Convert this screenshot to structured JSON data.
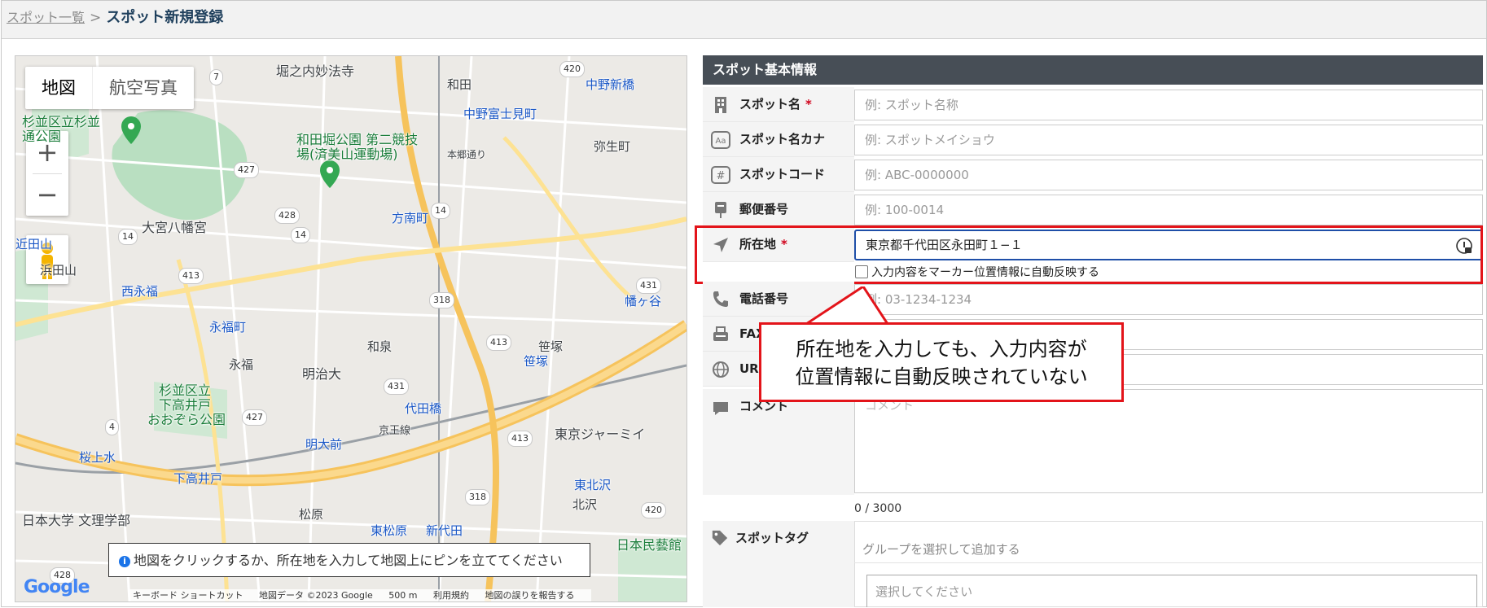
{
  "breadcrumb": {
    "parent": "スポット一覧",
    "separator": ">",
    "current": "スポット新規登録"
  },
  "map": {
    "types": [
      "地図",
      "航空写真"
    ],
    "zoom_in": "+",
    "zoom_out": "−",
    "hint": "地図をクリックするか、所在地を入力して地図上にピンを立ててください",
    "hint_icon": "i",
    "google": "Google",
    "footer": [
      "キーボード ショートカット",
      "地図データ ©2023 Google",
      "500 m",
      "利用規約",
      "地図の誤りを報告する"
    ],
    "labels": [
      {
        "t": "堀之内妙法寺",
        "c": ""
      },
      {
        "t": "和田",
        "c": ""
      },
      {
        "t": "中野新橋",
        "c": "blue"
      },
      {
        "t": "中野富士見町",
        "c": "blue"
      },
      {
        "t": "杉並区立杉並",
        "c": "green"
      },
      {
        "t": "通公園",
        "c": "green"
      },
      {
        "t": "和田堀公園 第二競技",
        "c": "green"
      },
      {
        "t": "場(済美山運動場)",
        "c": "green"
      },
      {
        "t": "本郷通り",
        "c": ""
      },
      {
        "t": "弥生町",
        "c": ""
      },
      {
        "t": "大宮八幡宮",
        "c": "big"
      },
      {
        "t": "方南町",
        "c": "blue"
      },
      {
        "t": "浜田山",
        "c": ""
      },
      {
        "t": "西永福",
        "c": "blue"
      },
      {
        "t": "永福町",
        "c": "blue"
      },
      {
        "t": "和泉",
        "c": ""
      },
      {
        "t": "幡ヶ谷",
        "c": "blue"
      },
      {
        "t": "笹塚",
        "c": ""
      },
      {
        "t": "笹塚",
        "c": "blue"
      },
      {
        "t": "永福",
        "c": ""
      },
      {
        "t": "明治大",
        "c": ""
      },
      {
        "t": "杉並区立",
        "c": "green"
      },
      {
        "t": "下高井戸",
        "c": "green"
      },
      {
        "t": "おおぞら公園",
        "c": "green"
      },
      {
        "t": "代田橋",
        "c": "blue"
      },
      {
        "t": "京王線",
        "c": ""
      },
      {
        "t": "明大前",
        "c": "blue"
      },
      {
        "t": "東京ジャーミイ",
        "c": "big"
      },
      {
        "t": "桜上水",
        "c": "blue"
      },
      {
        "t": "下高井戸",
        "c": "blue"
      },
      {
        "t": "東北沢",
        "c": "blue"
      },
      {
        "t": "北沢",
        "c": ""
      },
      {
        "t": "日本大学 文理学部",
        "c": "big"
      },
      {
        "t": "松原",
        "c": ""
      },
      {
        "t": "東松原",
        "c": "blue"
      },
      {
        "t": "新代田",
        "c": "blue"
      },
      {
        "t": "日本民藝館",
        "c": "green"
      },
      {
        "t": "近田山",
        "c": "blue"
      }
    ],
    "shields": [
      "7",
      "420",
      "427",
      "428",
      "14",
      "14",
      "14",
      "413",
      "318",
      "413",
      "431",
      "431",
      "4",
      "427",
      "413",
      "318",
      "420",
      "428"
    ]
  },
  "form": {
    "section_title": "スポット基本情報",
    "fields": [
      {
        "label": "スポット名",
        "required": true,
        "value": "",
        "placeholder": "例: スポット名称",
        "icon": "building-icon"
      },
      {
        "label": "スポット名カナ",
        "required": false,
        "value": "",
        "placeholder": "例: スポットメイショウ",
        "icon": "kana-icon"
      },
      {
        "label": "スポットコード",
        "required": false,
        "value": "",
        "placeholder": "例: ABC-0000000",
        "icon": "hash-icon"
      },
      {
        "label": "郵便番号",
        "required": false,
        "value": "",
        "placeholder": "例: 100-0014",
        "icon": "postbox-icon"
      },
      {
        "label": "所在地",
        "required": true,
        "value": "東京都千代田区永田町１−１",
        "placeholder": "",
        "icon": "location-arrow-icon"
      },
      {
        "label": "電話番号",
        "required": false,
        "value": "",
        "placeholder": "例: 03-1234-1234",
        "icon": "phone-icon"
      },
      {
        "label": "FAX",
        "required": false,
        "value": "",
        "placeholder": "",
        "icon": "fax-icon"
      },
      {
        "label": "URL",
        "required": false,
        "value": "",
        "placeholder": "",
        "icon": "globe-icon"
      }
    ],
    "required_mark": "*",
    "auto_reflect_label": "入力内容をマーカー位置情報に自動反映する",
    "comment_label": "コメント",
    "comment_placeholder": "コメント",
    "comment_counter": "0 / 3000",
    "tag_label": "スポットタグ",
    "tag_group_placeholder": "グループを選択して追加する",
    "tag_select_placeholder": "選択してください"
  },
  "callout": {
    "line1": "所在地を入力しても、入力内容が",
    "line2": "位置情報に自動反映されていない"
  },
  "colors": {
    "header": "#474e56",
    "highlight": "#e3141a",
    "focus": "#1f4fa8",
    "crumb": "#1e3f5c"
  }
}
